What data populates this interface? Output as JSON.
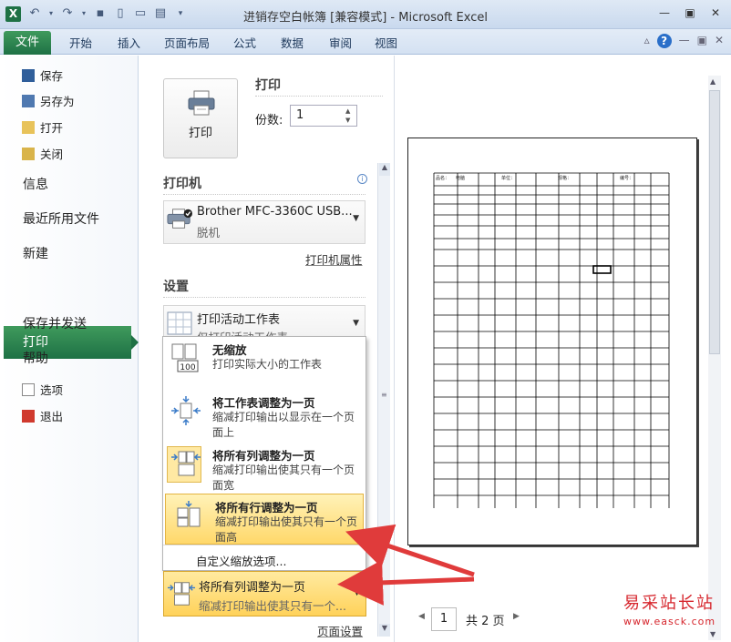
{
  "window": {
    "title": "进销存空白帐簿  [兼容模式]  -  Microsoft Excel",
    "logo": "X"
  },
  "ribbon": {
    "tabs": [
      "文件",
      "开始",
      "插入",
      "页面布局",
      "公式",
      "数据",
      "审阅",
      "视图"
    ]
  },
  "backstage_nav": {
    "small_top": [
      "保存",
      "另存为",
      "打开",
      "关闭"
    ],
    "big": [
      "信息",
      "最近所用文件",
      "新建",
      "打印",
      "保存并发送",
      "帮助"
    ],
    "active": "打印",
    "small_bottom": [
      "选项",
      "退出"
    ]
  },
  "print_panel": {
    "print_button": "打印",
    "print_heading": "打印",
    "copies_label": "份数:",
    "copies_value": "1",
    "printer_heading": "打印机",
    "printer_name": "Brother MFC-3360C USB...",
    "printer_status": "脱机",
    "printer_properties": "打印机属性",
    "settings_heading": "设置",
    "what_to_print": "打印活动工作表",
    "what_to_print_sub": "仅打印活动工作表",
    "page_setup": "页面设置"
  },
  "scaling_menu": {
    "options": [
      {
        "title": "无缩放",
        "desc": "打印实际大小的工作表",
        "icon_text": "100"
      },
      {
        "title": "将工作表调整为一页",
        "desc": "缩减打印输出以显示在一个页面上"
      },
      {
        "title": "将所有列调整为一页",
        "desc": "缩减打印输出使其只有一个页面宽"
      },
      {
        "title": "将所有行调整为一页",
        "desc": "缩减打印输出使其只有一个页面高"
      }
    ],
    "custom": "自定义缩放选项..."
  },
  "scale_dropdown": {
    "title": "将所有列调整为一页",
    "desc": "缩减打印输出使其只有一个..."
  },
  "preview": {
    "page_input": "1",
    "total_pages": "共 2 页",
    "header": [
      "品名：",
      "电脑",
      "单位：",
      "规格：",
      "编号："
    ]
  },
  "watermark": {
    "name": "易采站长站",
    "url": "www.easck.com"
  },
  "colors": {
    "excel_green": "#1e7145",
    "highlight": "#ffd86a",
    "arrow_red": "#e03b3b"
  }
}
